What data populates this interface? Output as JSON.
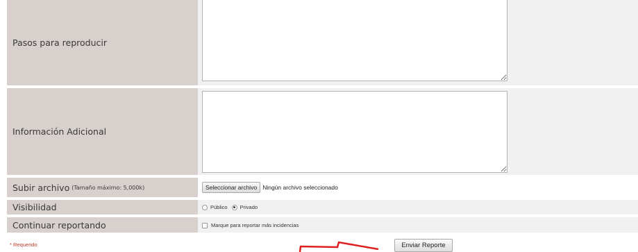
{
  "form": {
    "steps_label": "Pasos para reproducir",
    "info_label": "Información Adicional",
    "file_label": "Subir archivo",
    "file_note": "(Tamaño máximo: 5,000k)",
    "file_button": "Seleccionar archivo",
    "file_status": "Ningún archivo seleccionado",
    "visibility_label": "Visibilidad",
    "visibility_options": [
      "Público",
      "Privado"
    ],
    "visibility_selected": "Privado",
    "continue_label": "Continuar reportando",
    "continue_checkbox_label": "Marque para reportar más incidencias",
    "continue_checked": false,
    "required_note": "* Requerido",
    "submit_label": "Enviar Reporte"
  },
  "annotation": {
    "arrow_color": "#e01f1f"
  }
}
